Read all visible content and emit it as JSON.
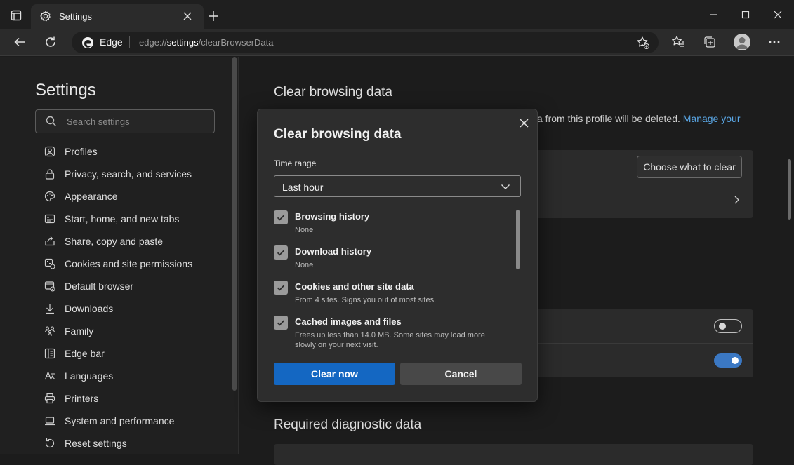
{
  "browser": {
    "tab_title": "Settings",
    "address_brand": "Edge",
    "url_prefix": "edge://",
    "url_host": "settings",
    "url_path": "/clearBrowserData"
  },
  "sidebar": {
    "title": "Settings",
    "search_placeholder": "Search settings",
    "items": [
      {
        "label": "Profiles",
        "icon": "profile-icon"
      },
      {
        "label": "Privacy, search, and services",
        "icon": "lock-icon"
      },
      {
        "label": "Appearance",
        "icon": "palette-icon"
      },
      {
        "label": "Start, home, and new tabs",
        "icon": "home-icon"
      },
      {
        "label": "Share, copy and paste",
        "icon": "share-icon"
      },
      {
        "label": "Cookies and site permissions",
        "icon": "cookies-icon"
      },
      {
        "label": "Default browser",
        "icon": "browser-icon"
      },
      {
        "label": "Downloads",
        "icon": "download-icon"
      },
      {
        "label": "Family",
        "icon": "family-icon"
      },
      {
        "label": "Edge bar",
        "icon": "edge-bar-icon"
      },
      {
        "label": "Languages",
        "icon": "languages-icon"
      },
      {
        "label": "Printers",
        "icon": "printer-icon"
      },
      {
        "label": "System and performance",
        "icon": "laptop-icon"
      },
      {
        "label": "Reset settings",
        "icon": "reset-icon"
      }
    ]
  },
  "main": {
    "heading": "Clear browsing data",
    "partial_text": "a from this profile will be deleted.",
    "manage_link": "Manage your",
    "choose_button": "Choose what to clear",
    "toggle_1_on": false,
    "toggle_2_on": true,
    "heading_2": "Required diagnostic data"
  },
  "dialog": {
    "title": "Clear browsing data",
    "time_range_label": "Time range",
    "time_range_value": "Last hour",
    "options": [
      {
        "title": "Browsing history",
        "desc": "None",
        "checked": true
      },
      {
        "title": "Download history",
        "desc": "None",
        "checked": true
      },
      {
        "title": "Cookies and other site data",
        "desc": "From 4 sites. Signs you out of most sites.",
        "checked": true
      },
      {
        "title": "Cached images and files",
        "desc": "Frees up less than 14.0 MB. Some sites may load more slowly on your next visit.",
        "checked": true
      }
    ],
    "clear_button": "Clear now",
    "cancel_button": "Cancel"
  },
  "colors": {
    "accent": "#1467c2",
    "link": "#5aa7e6",
    "toggle_on": "#3b78c3"
  }
}
